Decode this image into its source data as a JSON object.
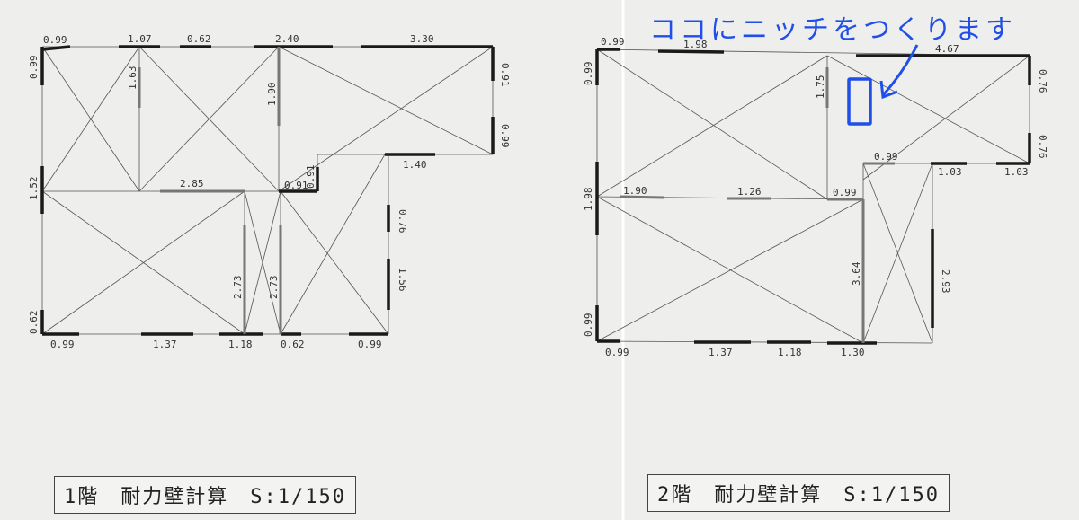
{
  "floor1": {
    "caption": "1階　耐力壁計算　S:1/150",
    "labels": [
      "0.99",
      "1.07",
      "0.62",
      "2.40",
      "3.30",
      "0.99",
      "1.63",
      "1.90",
      "0.91",
      "0.99",
      "1.52",
      "2.85",
      "0.91",
      "0.91",
      "1.40",
      "0.76",
      "2.73",
      "2.73",
      "1.56",
      "0.62",
      "0.99",
      "1.37",
      "1.18",
      "0.62",
      "0.99"
    ]
  },
  "floor2": {
    "caption": "2階　耐力壁計算　S:1/150",
    "labels": [
      "0.99",
      "1.98",
      "4.67",
      "0.99",
      "0.76",
      "1.75",
      "0.99",
      "0.76",
      "1.03",
      "1.03",
      "1.98",
      "1.90",
      "1.26",
      "0.99",
      "3.64",
      "2.93",
      "0.99",
      "0.99",
      "1.37",
      "1.18",
      "1.30"
    ]
  },
  "annotation": {
    "text": "ココにニッチをつくります",
    "color": "#1f4fe8"
  }
}
